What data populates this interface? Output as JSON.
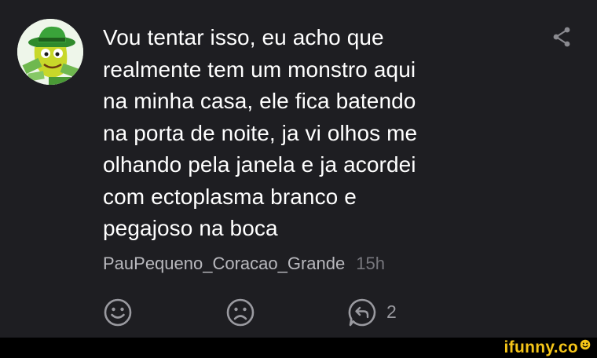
{
  "comment": {
    "text": "Vou tentar isso, eu acho que\nrealmente tem um monstro aqui\nna minha casa, ele fica batendo\nna porta de noite, ja vi olhos me\nolhando pela janela e ja acordei\ncom ectoplasma branco e\npegajoso na boca",
    "username": "PauPequeno_Coracao_Grande",
    "time": "15h",
    "reply_count": "2"
  },
  "icons": {
    "share": "share-icon",
    "like": "smile-icon",
    "dislike": "frown-icon",
    "reply": "reply-icon"
  },
  "watermark": {
    "text": "ifunny.co"
  },
  "colors": {
    "background": "#1e1e22",
    "text": "#ffffff",
    "username": "#b9b9be",
    "muted": "#77777d",
    "icon": "#9a9aa0",
    "brand": "#f5c518"
  }
}
